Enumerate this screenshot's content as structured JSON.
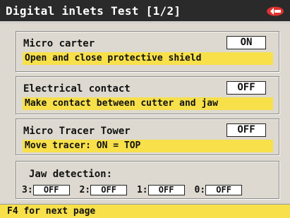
{
  "header": {
    "title": "Digital inlets Test [1/2]",
    "logo_icon": "brand-logo-icon",
    "logo_color": "#e03030"
  },
  "inlets": [
    {
      "title": "Micro carter",
      "state": "ON",
      "description": "Open and close protective shield"
    },
    {
      "title": "Electrical contact",
      "state": "OFF",
      "description": "Make contact between cutter and jaw"
    },
    {
      "title": "Micro Tracer Tower",
      "state": "OFF",
      "description": "Move tracer: ON = TOP"
    }
  ],
  "jaw": {
    "title": "Jaw detection:",
    "items": [
      {
        "label": "3:",
        "state": "OFF"
      },
      {
        "label": "2:",
        "state": "OFF"
      },
      {
        "label": "1:",
        "state": "OFF"
      },
      {
        "label": "0:",
        "state": "OFF"
      }
    ]
  },
  "footer": {
    "hint": "F4 for next page"
  },
  "colors": {
    "accent_yellow": "#f7e04a",
    "titlebar": "#2a2a2a",
    "panel": "#ddd9d0"
  }
}
